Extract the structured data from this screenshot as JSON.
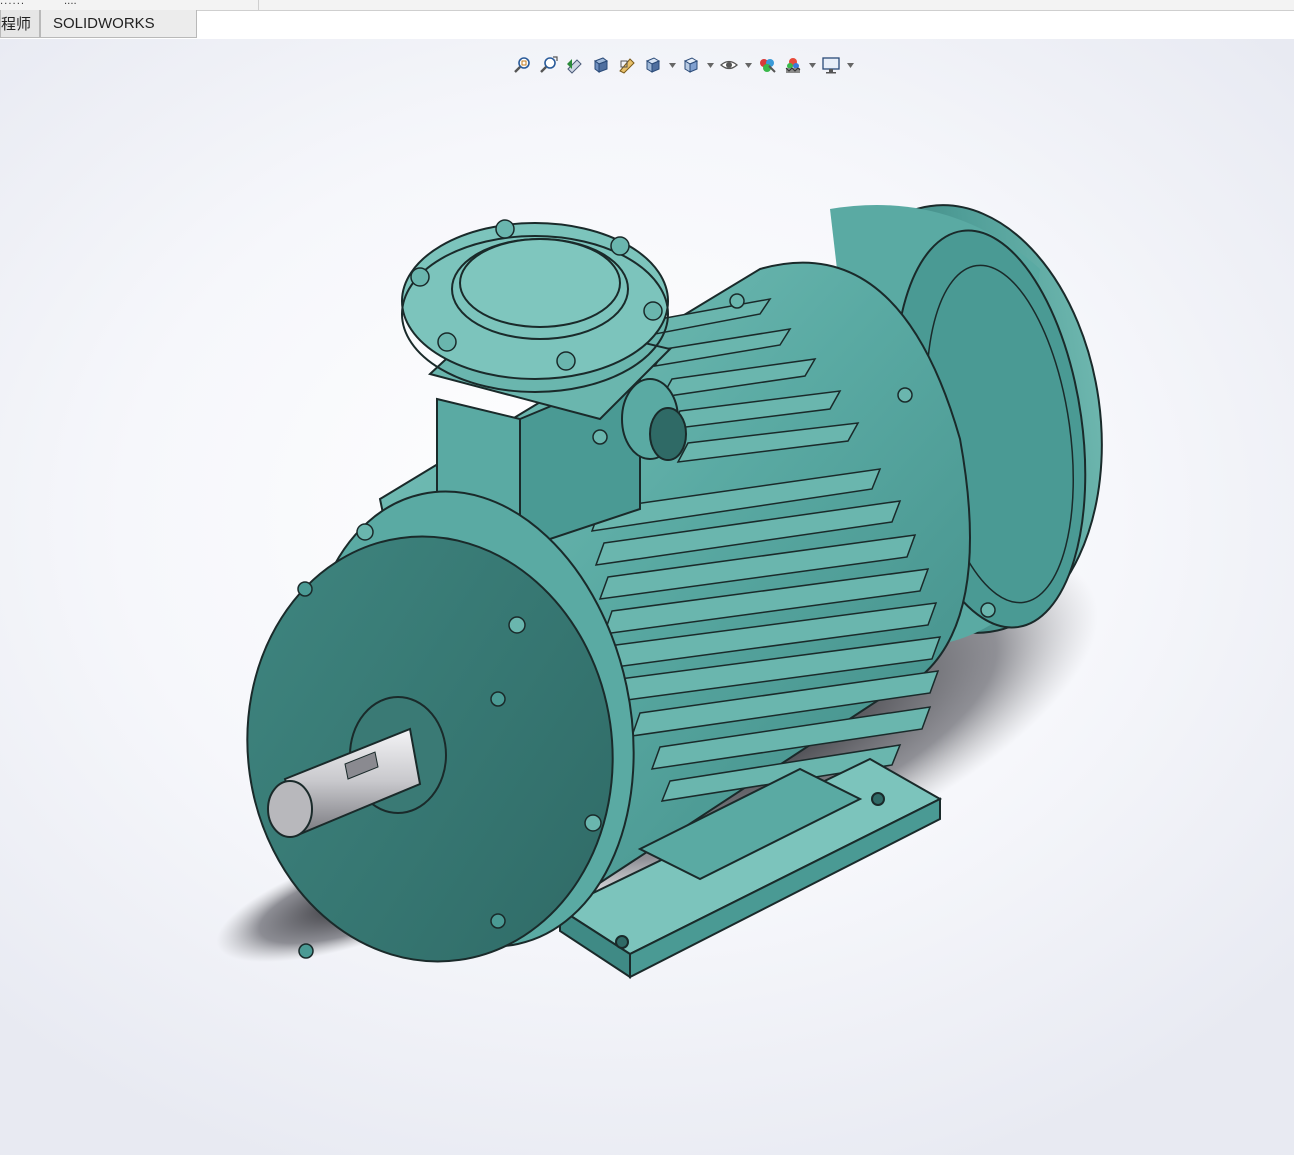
{
  "window": {
    "titlebar_fragment_left": "......",
    "titlebar_fragment_right": "...."
  },
  "tabs": [
    {
      "label": "程师"
    },
    {
      "label": "SOLIDWORKS CAM"
    }
  ],
  "heads_up_toolbar": [
    {
      "icon": "zoom-to-fit-icon"
    },
    {
      "icon": "zoom-to-area-icon"
    },
    {
      "icon": "previous-view-icon"
    },
    {
      "icon": "section-view-icon"
    },
    {
      "icon": "dynamic-annotation-view-icon"
    },
    {
      "icon": "view-orientation-icon",
      "dropdown": true
    },
    {
      "icon": "display-style-icon",
      "dropdown": true
    },
    {
      "icon": "hide-show-items-icon",
      "dropdown": true
    },
    {
      "icon": "edit-appearance-icon"
    },
    {
      "icon": "apply-scene-icon",
      "dropdown": true
    },
    {
      "icon": "view-settings-icon",
      "dropdown": true
    }
  ],
  "colors": {
    "model_body": "#4a9a94",
    "model_highlight": "#7cc4bc",
    "model_shadow": "#2f6a66",
    "edge": "#1a2a2a",
    "shaft": "#c8c8cc",
    "ground_shadow": "#1e1e22"
  }
}
